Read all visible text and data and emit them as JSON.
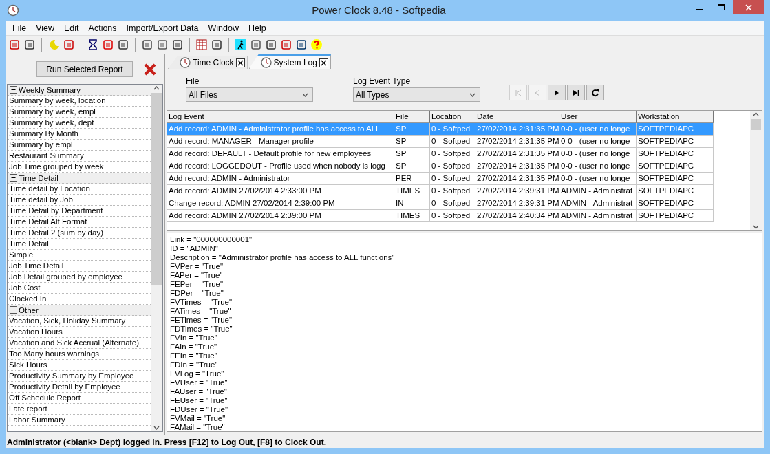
{
  "window": {
    "title": "Power Clock 8.48 - Softpedia"
  },
  "menu": [
    "File",
    "View",
    "Edit",
    "Actions",
    "Import/Export Data",
    "Window",
    "Help"
  ],
  "run_button": {
    "label": "Run Selected Report"
  },
  "report_tree": [
    {
      "label": "Weekly Summary",
      "expanded": true,
      "children": [
        {
          "label": "Summary by week, location"
        },
        {
          "label": "Summary by week, empl"
        },
        {
          "label": "Summary by week, dept"
        },
        {
          "label": "Summary By Month"
        },
        {
          "label": "Summary by empl"
        },
        {
          "label": "Restaurant Summary"
        },
        {
          "label": "Job Time grouped by week"
        }
      ]
    },
    {
      "label": "Time Detail",
      "expanded": true,
      "children": [
        {
          "label": "Time detail by Location"
        },
        {
          "label": "Time detail by Job"
        },
        {
          "label": "Time Detail by Department"
        },
        {
          "label": "Time Detail Alt Format"
        },
        {
          "label": "Time Detail 2 (sum by day)"
        },
        {
          "label": "Time Detail"
        },
        {
          "label": "Simple"
        },
        {
          "label": "Job Time Detail"
        },
        {
          "label": "Job Detail grouped by employee"
        },
        {
          "label": "Job Cost"
        },
        {
          "label": "Clocked In"
        }
      ]
    },
    {
      "label": "Other",
      "expanded": true,
      "children": [
        {
          "label": "Vacation, Sick, Holiday Summary"
        },
        {
          "label": "Vacation Hours"
        },
        {
          "label": "Vacation and Sick Accrual (Alternate)"
        },
        {
          "label": "Too Many hours warnings"
        },
        {
          "label": "Sick Hours"
        },
        {
          "label": "Productivity Summary by Employee"
        },
        {
          "label": "Productivity Detail by Employee"
        },
        {
          "label": "Off Schedule Report"
        },
        {
          "label": "Late report"
        },
        {
          "label": "Labor Summary"
        }
      ]
    }
  ],
  "tabs": [
    {
      "label": "Time Clock",
      "selected": false
    },
    {
      "label": "System Log",
      "selected": true
    }
  ],
  "filters": [
    {
      "label": "File",
      "value": "All Files"
    },
    {
      "label": "Log Event Type",
      "value": "All Types"
    }
  ],
  "nav_buttons": [
    {
      "kind": "first",
      "disabled": true
    },
    {
      "kind": "prev",
      "disabled": true
    },
    {
      "kind": "next",
      "disabled": false
    },
    {
      "kind": "last",
      "disabled": false
    },
    {
      "kind": "refresh",
      "disabled": false
    }
  ],
  "table": {
    "columns": [
      "Log Event",
      "File",
      "Location",
      "Date",
      "User",
      "Workstation"
    ],
    "rows": [
      {
        "selected": true,
        "cells": [
          "Add record: ADMIN - Administrator profile has access to ALL",
          "SP",
          "0 - Softped",
          "27/02/2014 2:31:35 PM",
          "0-0 - (user no longe",
          "SOFTPEDIAPC"
        ]
      },
      {
        "selected": false,
        "cells": [
          "Add record: MANAGER - Manager profile",
          "SP",
          "0 - Softped",
          "27/02/2014 2:31:35 PM",
          "0-0 - (user no longe",
          "SOFTPEDIAPC"
        ]
      },
      {
        "selected": false,
        "cells": [
          "Add record: DEFAULT - Default profile for new employees",
          "SP",
          "0 - Softped",
          "27/02/2014 2:31:35 PM",
          "0-0 - (user no longe",
          "SOFTPEDIAPC"
        ]
      },
      {
        "selected": false,
        "cells": [
          "Add record: LOGGEDOUT - Profile used when nobody is logg",
          "SP",
          "0 - Softped",
          "27/02/2014 2:31:35 PM",
          "0-0 - (user no longe",
          "SOFTPEDIAPC"
        ]
      },
      {
        "selected": false,
        "cells": [
          "Add record: ADMIN - Administrator",
          "PER",
          "0 - Softped",
          "27/02/2014 2:31:35 PM",
          "0-0 - (user no longe",
          "SOFTPEDIAPC"
        ]
      },
      {
        "selected": false,
        "cells": [
          "Add record: ADMIN 27/02/2014 2:33:00 PM",
          "TIMES",
          "0 - Softped",
          "27/02/2014 2:39:31 PM",
          "ADMIN - Administrat",
          "SOFTPEDIAPC"
        ]
      },
      {
        "selected": false,
        "cells": [
          "Change record: ADMIN 27/02/2014 2:39:00 PM",
          "IN",
          "0 - Softped",
          "27/02/2014 2:39:31 PM",
          "ADMIN - Administrat",
          "SOFTPEDIAPC"
        ]
      },
      {
        "selected": false,
        "cells": [
          "Add record: ADMIN 27/02/2014 2:39:00 PM",
          "TIMES",
          "0 - Softped",
          "27/02/2014 2:40:34 PM",
          "ADMIN - Administrat",
          "SOFTPEDIAPC"
        ]
      }
    ]
  },
  "detail_lines": [
    "Link = \"000000000001\"",
    "ID = \"ADMIN\"",
    "Description = \"Administrator profile has access to ALL functions\"",
    "FVPer = \"True\"",
    "FAPer = \"True\"",
    "FEPer = \"True\"",
    "FDPer = \"True\"",
    "FVTimes = \"True\"",
    "FATimes = \"True\"",
    "FETimes = \"True\"",
    "FDTimes = \"True\"",
    "FVIn = \"True\"",
    "FAIn = \"True\"",
    "FEIn = \"True\"",
    "FDIn = \"True\"",
    "FVLog = \"True\"",
    "FVUser = \"True\"",
    "FAUser = \"True\"",
    "FEUser = \"True\"",
    "FDUser = \"True\"",
    "FVMail = \"True\"",
    "FAMail = \"True\""
  ],
  "status_bar": "Administrator (<blank> Dept) logged in.  Press [F12] to Log Out, [F8] to Clock Out."
}
